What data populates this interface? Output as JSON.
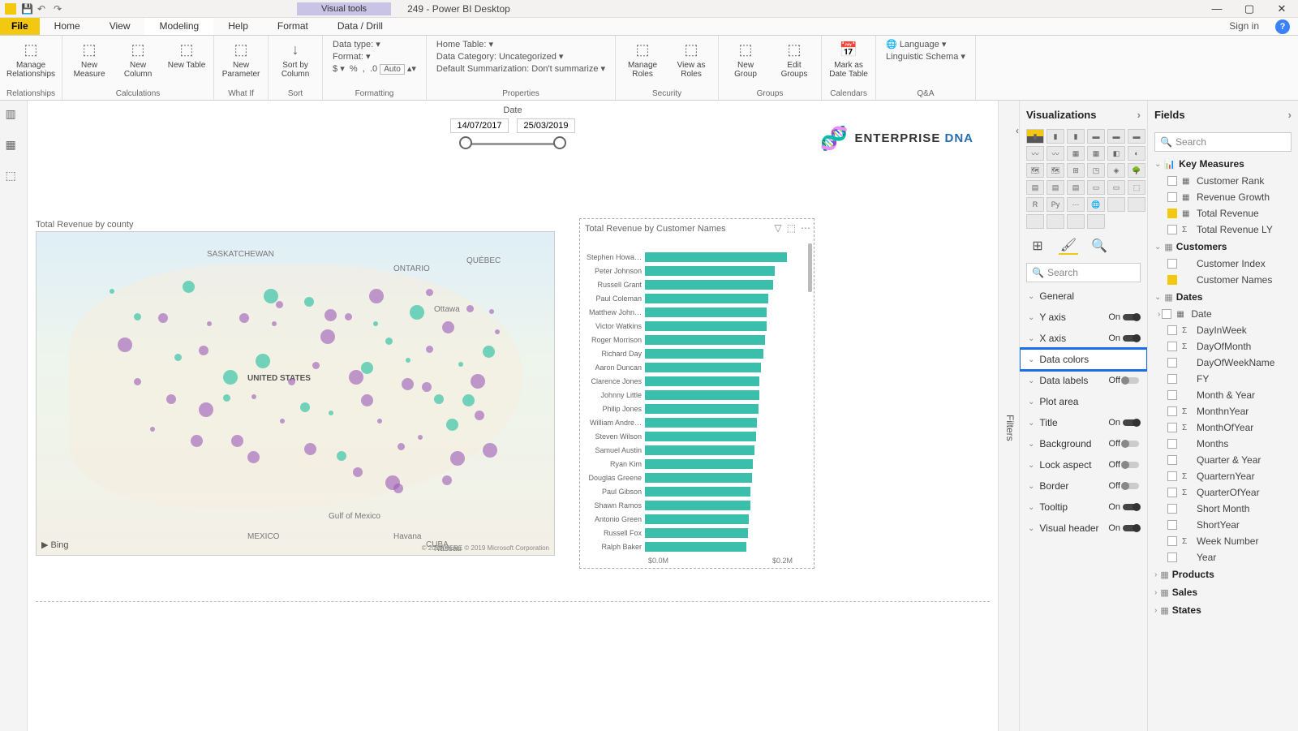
{
  "titlebar": {
    "visual_tools": "Visual tools",
    "title": "249 - Power BI Desktop"
  },
  "tabs": {
    "file": "File",
    "items": [
      "Home",
      "View",
      "Modeling",
      "Help",
      "Format",
      "Data / Drill"
    ],
    "active": "Modeling",
    "signin": "Sign in"
  },
  "ribbon": {
    "relationships": {
      "label": "Relationships",
      "btn": "Manage\nRelationships"
    },
    "calculations": {
      "label": "Calculations",
      "btns": [
        "New\nMeasure",
        "New\nColumn",
        "New\nTable"
      ]
    },
    "whatif": {
      "label": "What If",
      "btn": "New\nParameter"
    },
    "sort": {
      "label": "Sort",
      "btn": "Sort by\nColumn"
    },
    "formatting": {
      "label": "Formatting",
      "datatype": "Data type:",
      "format": "Format:",
      "auto": "Auto"
    },
    "properties": {
      "label": "Properties",
      "hometable": "Home Table:",
      "category": "Data Category: Uncategorized",
      "summarization": "Default Summarization: Don't summarize"
    },
    "security": {
      "label": "Security",
      "btns": [
        "Manage\nRoles",
        "View as\nRoles"
      ]
    },
    "groups": {
      "label": "Groups",
      "btns": [
        "New\nGroup",
        "Edit\nGroups"
      ]
    },
    "calendars": {
      "label": "Calendars",
      "btn": "Mark as\nDate Table"
    },
    "qa": {
      "label": "Q&A",
      "language": "Language",
      "schema": "Linguistic Schema"
    }
  },
  "canvas": {
    "date_label": "Date",
    "date_from": "14/07/2017",
    "date_to": "25/03/2019",
    "brand1": "ENTERPRISE",
    "brand2": "DNA",
    "map_title": "Total Revenue by county",
    "map_labels": {
      "country": "UNITED STATES",
      "gulf": "Gulf of Mexico",
      "mexico": "MEXICO",
      "havana": "Havana",
      "cuba": "CUBA",
      "ontario": "ONTARIO",
      "quebec": "QUÉBEC",
      "sask": "SASKATCHEWAN",
      "ottawa": "Ottawa",
      "nassau": "Nassau",
      "bing": "Bing",
      "credit": "© 2019 HERE © 2019 Microsoft Corporation"
    },
    "bar_title": "Total Revenue by Customer Names",
    "bar_axis_min": "$0.0M",
    "bar_axis_max": "$0.2M"
  },
  "chart_data": {
    "type": "bar",
    "title": "Total Revenue by Customer Names",
    "xlabel": "",
    "ylabel": "",
    "xlim_label": [
      "$0.0M",
      "$0.2M"
    ],
    "categories": [
      "Stephen Howa…",
      "Peter Johnson",
      "Russell Grant",
      "Paul Coleman",
      "Matthew John…",
      "Victor Watkins",
      "Roger Morrison",
      "Richard Day",
      "Aaron Duncan",
      "Clarence Jones",
      "Johnny Little",
      "Philip Jones",
      "William Andre…",
      "Steven Wilson",
      "Samuel Austin",
      "Ryan Kim",
      "Douglas Greene",
      "Paul Gibson",
      "Shawn Ramos",
      "Antonio Green",
      "Russell Fox",
      "Ralph Baker"
    ],
    "values": [
      175,
      160,
      158,
      152,
      150,
      150,
      148,
      146,
      143,
      141,
      141,
      140,
      138,
      137,
      135,
      133,
      132,
      130,
      130,
      128,
      127,
      125
    ]
  },
  "filters_label": "Filters",
  "vis": {
    "header": "Visualizations",
    "search": "Search",
    "format_rows": [
      {
        "label": "General",
        "toggle": null
      },
      {
        "label": "Y axis",
        "toggle": "On"
      },
      {
        "label": "X axis",
        "toggle": "On"
      },
      {
        "label": "Data colors",
        "toggle": null,
        "selected": true
      },
      {
        "label": "Data labels",
        "toggle": "Off"
      },
      {
        "label": "Plot area",
        "toggle": null
      },
      {
        "label": "Title",
        "toggle": "On"
      },
      {
        "label": "Background",
        "toggle": "Off"
      },
      {
        "label": "Lock aspect",
        "toggle": "Off"
      },
      {
        "label": "Border",
        "toggle": "Off"
      },
      {
        "label": "Tooltip",
        "toggle": "On"
      },
      {
        "label": "Visual header",
        "toggle": "On"
      }
    ]
  },
  "fields": {
    "header": "Fields",
    "search": "Search",
    "tables": [
      {
        "name": "Key Measures",
        "icon": "📊",
        "expanded": true,
        "fields": [
          {
            "name": "Customer Rank",
            "icon": "▦",
            "checked": false
          },
          {
            "name": "Revenue Growth",
            "icon": "▦",
            "checked": false
          },
          {
            "name": "Total Revenue",
            "icon": "▦",
            "checked": true
          },
          {
            "name": "Total Revenue LY",
            "icon": "Σ",
            "checked": false
          }
        ]
      },
      {
        "name": "Customers",
        "icon": "▦",
        "expanded": true,
        "fields": [
          {
            "name": "Customer Index",
            "icon": "",
            "checked": false
          },
          {
            "name": "Customer Names",
            "icon": "",
            "checked": true
          }
        ]
      },
      {
        "name": "Dates",
        "icon": "▦",
        "expanded": true,
        "fields": [
          {
            "name": "Date",
            "icon": "▦",
            "checked": false,
            "chev": true
          },
          {
            "name": "DayInWeek",
            "icon": "Σ",
            "checked": false
          },
          {
            "name": "DayOfMonth",
            "icon": "Σ",
            "checked": false
          },
          {
            "name": "DayOfWeekName",
            "icon": "",
            "checked": false
          },
          {
            "name": "FY",
            "icon": "",
            "checked": false
          },
          {
            "name": "Month & Year",
            "icon": "",
            "checked": false
          },
          {
            "name": "MonthnYear",
            "icon": "Σ",
            "checked": false
          },
          {
            "name": "MonthOfYear",
            "icon": "Σ",
            "checked": false
          },
          {
            "name": "Months",
            "icon": "",
            "checked": false
          },
          {
            "name": "Quarter & Year",
            "icon": "",
            "checked": false
          },
          {
            "name": "QuarternYear",
            "icon": "Σ",
            "checked": false
          },
          {
            "name": "QuarterOfYear",
            "icon": "Σ",
            "checked": false
          },
          {
            "name": "Short Month",
            "icon": "",
            "checked": false
          },
          {
            "name": "ShortYear",
            "icon": "",
            "checked": false
          },
          {
            "name": "Week Number",
            "icon": "Σ",
            "checked": false
          },
          {
            "name": "Year",
            "icon": "",
            "checked": false
          }
        ]
      },
      {
        "name": "Products",
        "icon": "▦",
        "expanded": false
      },
      {
        "name": "Sales",
        "icon": "▦",
        "expanded": false
      },
      {
        "name": "States",
        "icon": "▦",
        "expanded": false
      }
    ]
  }
}
